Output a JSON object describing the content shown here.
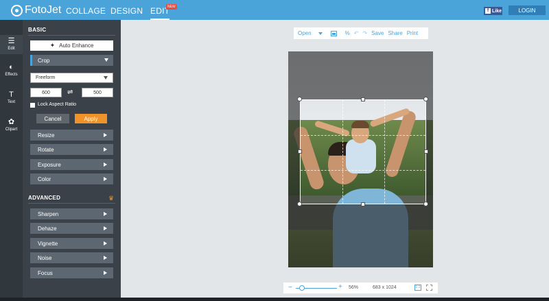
{
  "topbar": {
    "logo": "FotoJet",
    "nav": [
      "COLLAGE",
      "DESIGN",
      "EDIT"
    ],
    "new_badge": "NEW",
    "fb_like": "Like",
    "login": "LOGIN"
  },
  "rail": {
    "items": [
      {
        "label": "Edit",
        "icon": "sliders-icon"
      },
      {
        "label": "Effects",
        "icon": "effects-icon"
      },
      {
        "label": "Text",
        "icon": "text-icon"
      },
      {
        "label": "Clipart",
        "icon": "clipart-icon"
      }
    ]
  },
  "panel": {
    "basic_heading": "BASIC",
    "auto_enhance": "Auto Enhance",
    "crop": {
      "title": "Crop",
      "mode": "Freeform",
      "width": "600",
      "height": "500",
      "lock_label": "Lock Aspect Ratio",
      "lock_checked": false,
      "cancel": "Cancel",
      "apply": "Apply"
    },
    "basic_tools": [
      "Resize",
      "Rotate",
      "Exposure",
      "Color"
    ],
    "advanced_heading": "ADVANCED",
    "advanced_tools": [
      "Sharpen",
      "Dehaze",
      "Vignette",
      "Noise",
      "Focus"
    ]
  },
  "canvas_toolbar": {
    "open": "Open",
    "save": "Save",
    "share": "Share",
    "print": "Print"
  },
  "zoom": {
    "minus": "−",
    "plus": "+",
    "percent": "56%",
    "dimensions": "683 x 1024",
    "fit_label": "1:1",
    "level": 0.15
  },
  "colors": {
    "brand_blue": "#4aa4d9",
    "apply_orange": "#f0932b",
    "panel_bg": "#3a4148",
    "rail_bg": "#30373d"
  }
}
